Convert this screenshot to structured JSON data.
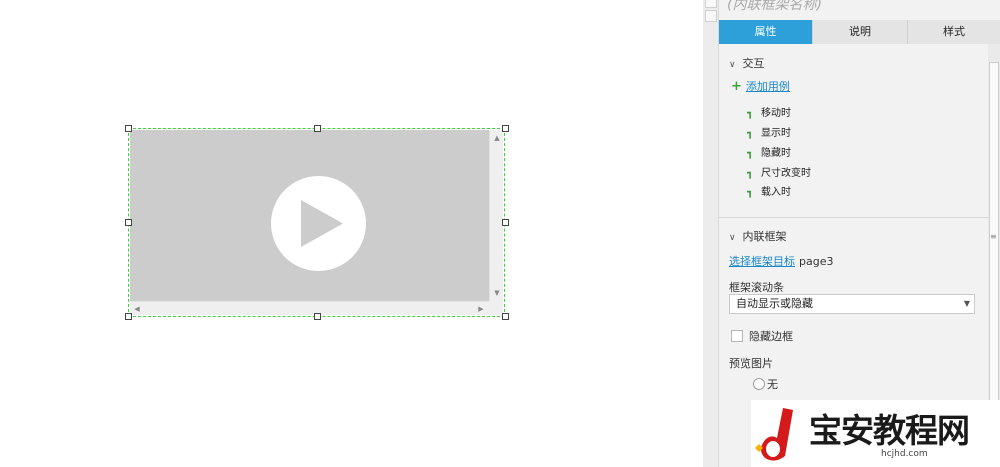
{
  "canvas": {
    "widget": {
      "accent": "#3ad13a",
      "placeholder_icon": "play-icon",
      "scroll_up_icon": "▲",
      "scroll_down_icon": "▼",
      "scroll_left_icon": "◀",
      "scroll_right_icon": "▶"
    }
  },
  "panel": {
    "title": "(内联框架名称)",
    "tabs": [
      {
        "label": "属性",
        "active": true
      },
      {
        "label": "说明",
        "active": false
      },
      {
        "label": "样式",
        "active": false
      }
    ],
    "interaction": {
      "header": "交互",
      "add_case": "添加用例",
      "events": [
        "移动时",
        "显示时",
        "隐藏时",
        "尺寸改变时",
        "载入时"
      ]
    },
    "inline_frame": {
      "header": "内联框架",
      "select_target_link": "选择框架目标",
      "target_value": "page3",
      "scrollbar_label": "框架滚动条",
      "scrollbar_value": "自动显示或隐藏",
      "hide_border_label": "隐藏边框",
      "preview_label": "预览图片",
      "preview_none": "无"
    },
    "accent": "#2d9fd9",
    "link_color": "#1a88c9"
  },
  "watermark": {
    "text": "宝安教程网",
    "url": "hcjhd.com"
  }
}
